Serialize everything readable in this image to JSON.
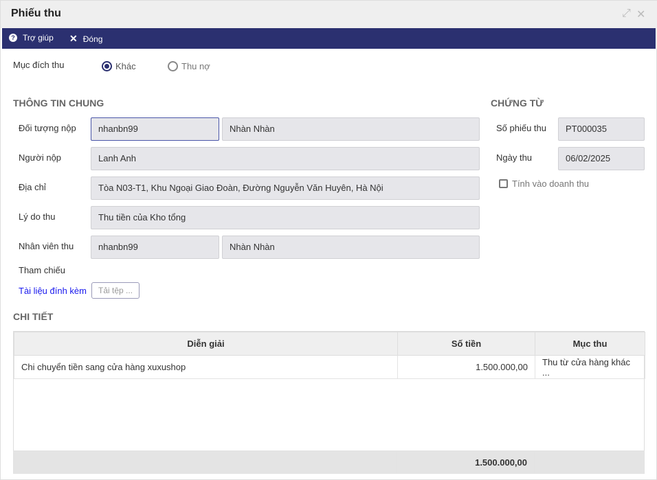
{
  "window": {
    "title": "Phiếu thu"
  },
  "toolbar": {
    "help": "Trợ giúp",
    "close": "Đóng"
  },
  "purpose": {
    "label": "Mục đích thu",
    "options": [
      "Khác",
      "Thu nợ"
    ],
    "selected": "Khác"
  },
  "general": {
    "heading": "THÔNG TIN CHUNG",
    "payer_label": "Đối tượng nộp",
    "payer_code": "nhanbn99",
    "payer_name": "Nhàn Nhàn",
    "person_label": "Người nộp",
    "person": "Lanh Anh",
    "address_label": "Địa chỉ",
    "address": "Tòa N03-T1, Khu Ngoại Giao Đoàn, Đường Nguyễn Văn Huyên, Hà Nội",
    "reason_label": "Lý do thu",
    "reason": "Thu tiền của Kho tổng",
    "staff_label": "Nhân viên thu",
    "staff_code": "nhanbn99",
    "staff_name": "Nhàn Nhàn",
    "reference_label": "Tham chiếu",
    "attachment_label": "Tài liệu đính kèm",
    "upload_label": "Tải tệp ..."
  },
  "voucher": {
    "heading": "CHỨNG TỪ",
    "number_label": "Số phiếu thu",
    "number": "PT000035",
    "date_label": "Ngày thu",
    "date": "06/02/2025",
    "revenue_label": "Tính vào doanh thu",
    "revenue_checked": false
  },
  "detail": {
    "heading": "CHI TIẾT",
    "columns": [
      "Diễn giải",
      "Số tiền",
      "Mục thu"
    ],
    "rows": [
      {
        "desc": "Chi chuyển tiền sang cửa hàng xuxushop",
        "amount": "1.500.000,00",
        "category": "Thu từ cửa hàng khác ..."
      }
    ],
    "total": "1.500.000,00"
  }
}
